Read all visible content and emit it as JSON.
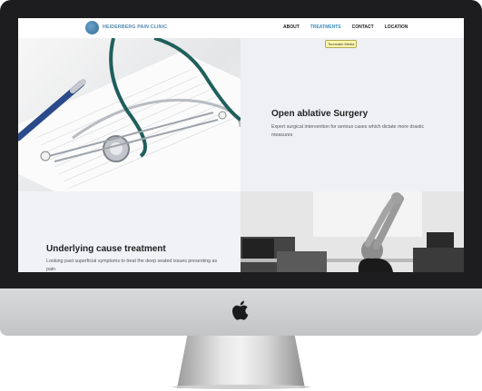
{
  "site": {
    "logo_text": "HEIDERBERG PAIN CLINIC",
    "nav": [
      {
        "label": "ABOUT",
        "active": false
      },
      {
        "label": "TREATMENTS",
        "active": true
      },
      {
        "label": "CONTACT",
        "active": false
      },
      {
        "label": "LOCATION",
        "active": false
      }
    ],
    "tooltip": "Tourmalin Media"
  },
  "sections": [
    {
      "heading": "Open ablative Surgery",
      "body": "Expert surgical intervention for serious cases which dictate more drastic measures",
      "image": "stethoscope-photo"
    },
    {
      "heading": "Underlying cause treatment",
      "body": "Looking past superficial symptoms to treat the deep seated issues presenting as pain",
      "image": "office-stretch-photo"
    }
  ],
  "device": {
    "brand_icon": "apple-logo-icon"
  }
}
